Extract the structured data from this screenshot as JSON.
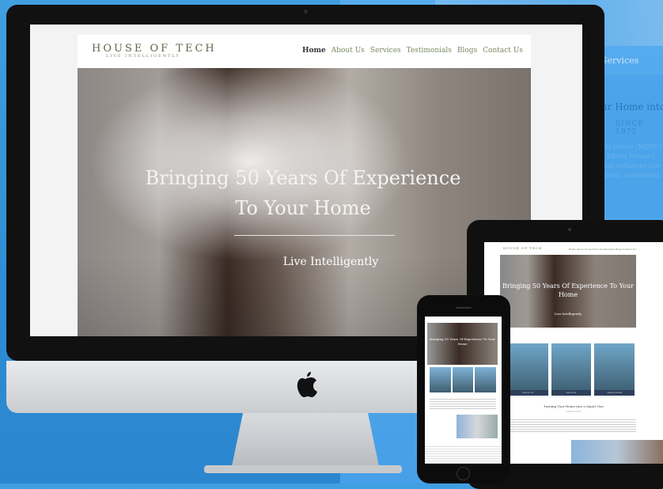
{
  "background_site": {
    "nav_label": "Services",
    "title_fragment": "ur Home into",
    "since": "SINCE 1972",
    "paragraph_fragment": "dio House (MBH) i a future forward, that enhances use odern, convenient,"
  },
  "desktop": {
    "logo_main": "HOUSE OF TECH",
    "logo_sub": "LIVE INTELLIGENTLY",
    "nav": [
      "Home",
      "About Us",
      "Services",
      "Testimonials",
      "Blogs",
      "Contact Us"
    ],
    "hero_title_line1": "Bringing 50 Years Of Experience",
    "hero_title_line2": "To Your Home",
    "hero_subtitle": "Live Intelligently"
  },
  "tablet": {
    "logo_main": "HOUSE OF TECH",
    "nav": "Home  About Us  Services  Testimonials  Blogs  Contact Us",
    "hero_title": "Bringing 50 Years Of Experience To Your Home",
    "hero_subtitle": "Live Intelligently",
    "tiles": [
      "About Us",
      "Services",
      "Testimonials"
    ],
    "section_title": "Turning Your Home into a Smart One",
    "section_since": "SINCE 1972"
  },
  "phone": {
    "hero_title": "Bringing 50 Years Of Experience To Your Home"
  }
}
